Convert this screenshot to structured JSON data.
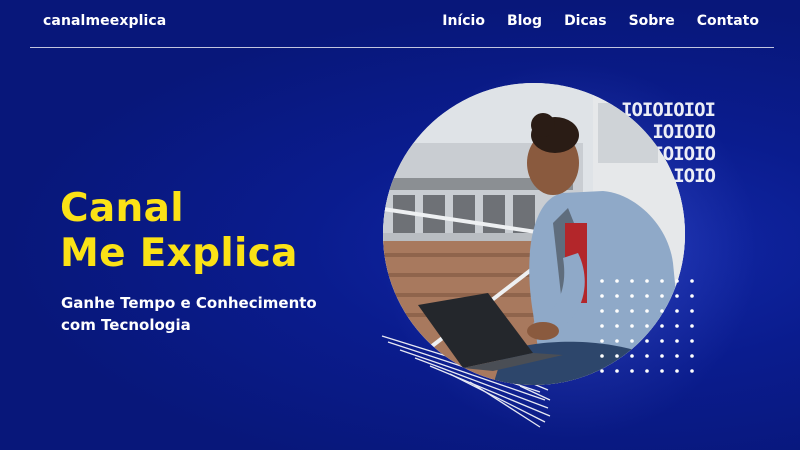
{
  "header": {
    "brand": "canalmeexplica",
    "nav": [
      "Início",
      "Blog",
      "Dicas",
      "Sobre",
      "Contato"
    ]
  },
  "hero": {
    "title_line1": "Canal",
    "title_line2": "Me Explica",
    "subtitle_line1": "Ganhe Tempo e Conhecimento",
    "subtitle_line2": "com Tecnologia"
  },
  "decor": {
    "binary_lines": [
      "IOIOIOIOI",
      "IOIOIO",
      "IOIOIO",
      "IOIO"
    ]
  },
  "colors": {
    "background": "#08177a",
    "accent_yellow": "#fbe216",
    "text": "#ffffff"
  },
  "icons": {
    "photo": "person-with-laptop-photo",
    "pattern": "dot-grid-pattern",
    "decoration": "brush-stroke-lines"
  }
}
